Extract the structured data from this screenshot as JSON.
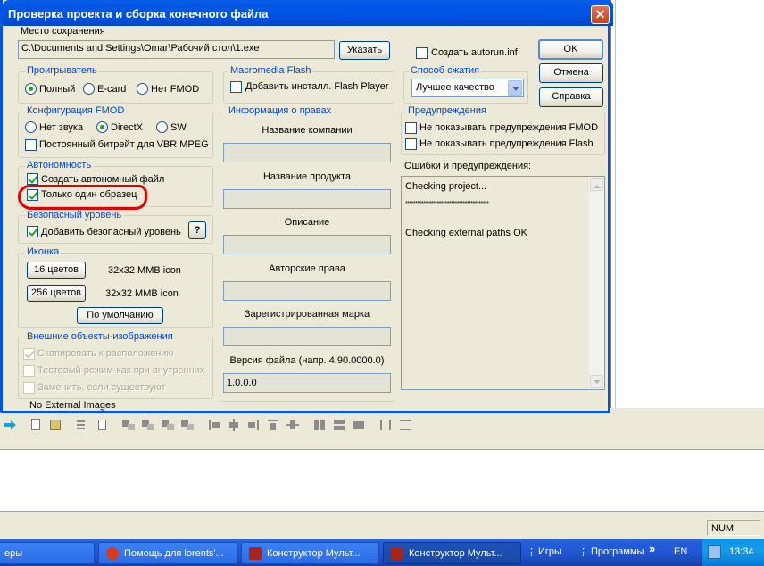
{
  "dialog": {
    "title": "Проверка проекта и сборка конечного файла",
    "close": "✕",
    "save_location": {
      "label": "Место сохранения",
      "path": "C:\\Documents and Settings\\Omar\\Рабочий стол\\1.exe",
      "browse": "Указать"
    },
    "autorun": {
      "label": "Создать autorun.inf",
      "checked": false
    },
    "buttons": {
      "ok": "OK",
      "cancel": "Отмена",
      "help": "Справка"
    },
    "player": {
      "label": "Проигрыватель",
      "options": [
        "Полный",
        "E-card",
        "Нет FMOD"
      ],
      "selected": 0
    },
    "flash": {
      "label": "Macromedia Flash",
      "checkbox": "Добавить инсталл. Flash Player",
      "checked": false
    },
    "compression": {
      "label": "Способ сжатия",
      "value": "Лучшее качество"
    },
    "fmod": {
      "label": "Конфигурация FMOD",
      "options": [
        "Нет звука",
        "DirectX",
        "SW"
      ],
      "selected": 1,
      "vbr": "Постоянный битрейт для VBR MPEG",
      "vbr_checked": false
    },
    "rights": {
      "label": "Информация о правах",
      "company": "Название компании",
      "product": "Название продукта",
      "description": "Описание",
      "copyright": "Авторские права",
      "trademark": "Зарегистрированная марка",
      "version_label": "Версия файла (напр. 4.90.0000.0)",
      "version": "1.0.0.0"
    },
    "warnings": {
      "label": "Предупреждения",
      "no_fmod": "Не показывать предупреждения FMOD",
      "no_flash": "Не показывать предупреждения Flash"
    },
    "errors": {
      "label": "Ошибки и предупреждения:",
      "lines": [
        "Checking project...",
        "******************************************",
        "Checking external paths OK"
      ]
    },
    "autonomy": {
      "label": "Автономность",
      "create": "Создать автономный файл",
      "single": "Только один образец"
    },
    "safe": {
      "label": "Безопасный уровень",
      "add": "Добавить безопасный уровень",
      "help": "?"
    },
    "icon": {
      "label": "Иконка",
      "b16": "16 цветов",
      "b16_desc": "32x32 MMB icon",
      "b256": "256 цветов",
      "b256_desc": "32x32 MMB icon",
      "default": "По умолчанию"
    },
    "external": {
      "label": "Внешние объекты-изображения",
      "copy": "Скопировать к расположению",
      "test": "Тестовый режим-как при внутренних",
      "replace": "Заменить, если существуют",
      "status": "No External Images"
    }
  },
  "statusbar": {
    "num": "NUM"
  },
  "taskbar": {
    "items": [
      {
        "label": "еры",
        "color": "#4a83d8"
      },
      {
        "label": "Помощь для lorents'...",
        "color": "#d83a1e"
      },
      {
        "label": "Конструктор Мульт...",
        "color": "#a8231a"
      },
      {
        "label": "Конструктор Мульт...",
        "color": "#a8231a"
      }
    ],
    "games": "Игры",
    "programs": "Программы",
    "chev": "»",
    "lang": "EN",
    "time": "13:34"
  }
}
